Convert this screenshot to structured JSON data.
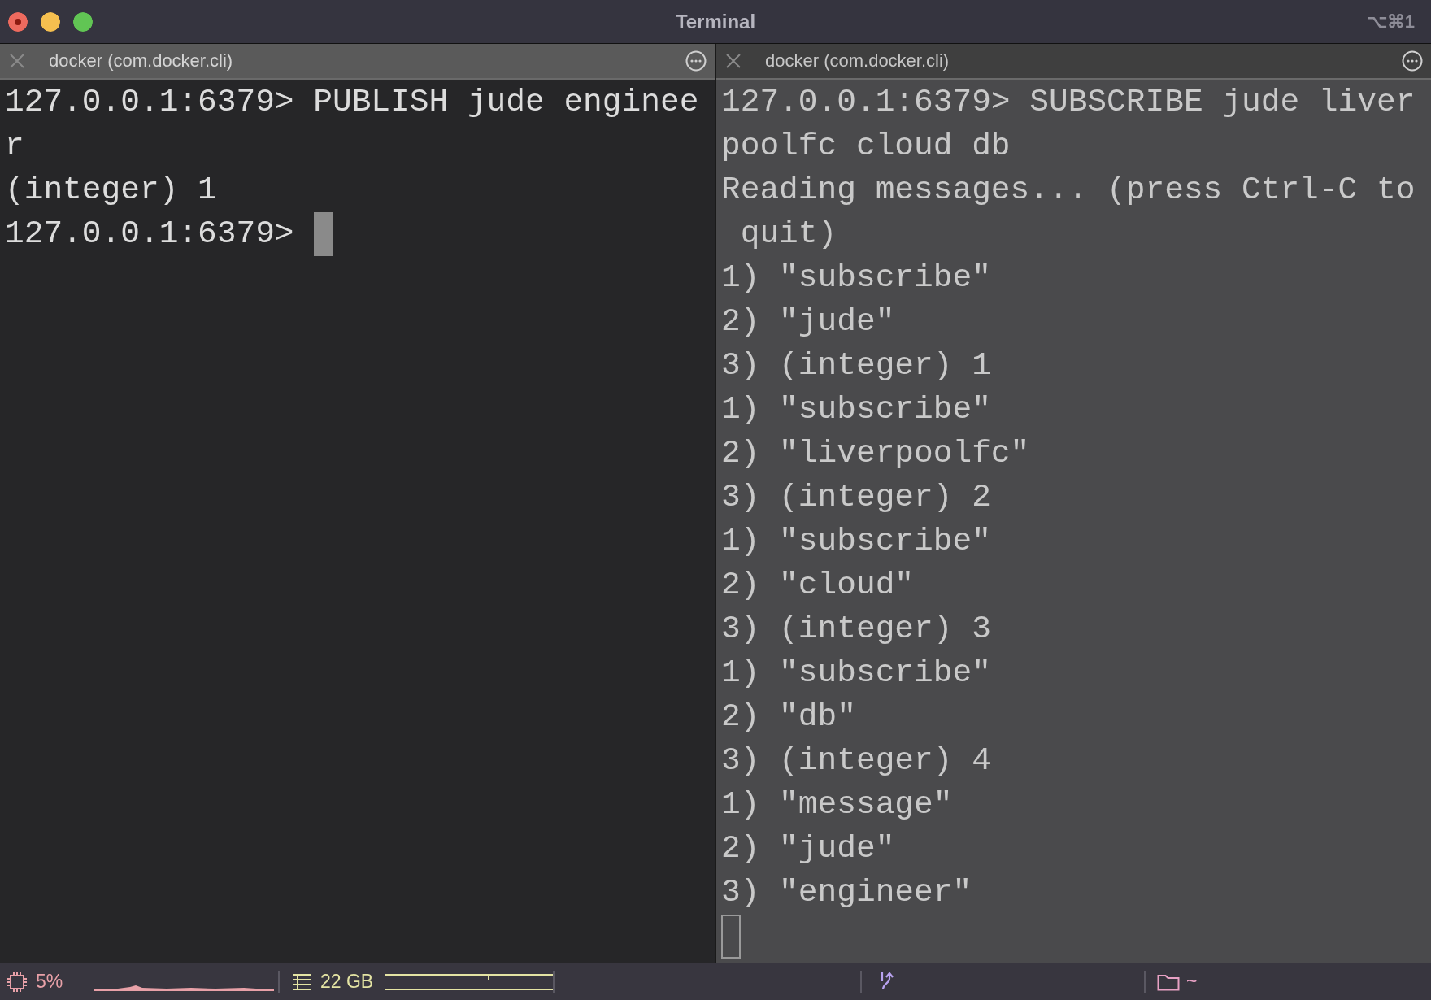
{
  "window": {
    "title": "Terminal",
    "shortcut": "⌥⌘1"
  },
  "panes": [
    {
      "tab": {
        "label": "docker (com.docker.cli)",
        "selected": true
      },
      "focused": true,
      "lines": [
        "127.0.0.1:6379> PUBLISH jude enginee",
        "r",
        "(integer) 1",
        "127.0.0.1:6379>"
      ]
    },
    {
      "tab": {
        "label": "docker (com.docker.cli)",
        "selected": false
      },
      "focused": false,
      "lines": [
        "127.0.0.1:6379> SUBSCRIBE jude liver",
        "poolfc cloud db",
        "Reading messages... (press Ctrl-C to",
        " quit)",
        "1) \"subscribe\"",
        "2) \"jude\"",
        "3) (integer) 1",
        "1) \"subscribe\"",
        "2) \"liverpoolfc\"",
        "3) (integer) 2",
        "1) \"subscribe\"",
        "2) \"cloud\"",
        "3) (integer) 3",
        "1) \"subscribe\"",
        "2) \"db\"",
        "3) (integer) 4",
        "1) \"message\"",
        "2) \"jude\"",
        "3) \"engineer\""
      ]
    }
  ],
  "status_bar": {
    "cpu": "5%",
    "memory": "22 GB",
    "directory": "~"
  }
}
